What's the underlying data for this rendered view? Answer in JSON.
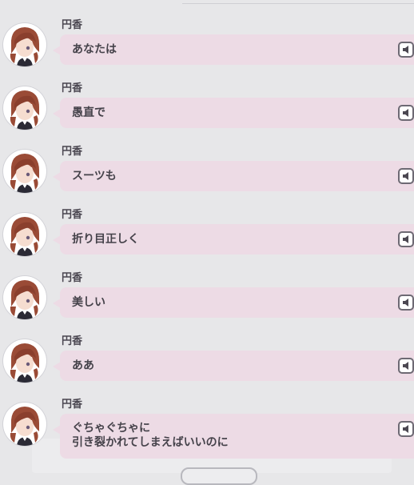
{
  "colors": {
    "background": "#e7e7e9",
    "bubble": "#eddbe5",
    "text": "#45424a",
    "name": "#4a4650"
  },
  "icons": {
    "avatar": "character-avatar-icon",
    "voice": "speaker-icon"
  },
  "messages": [
    {
      "speaker": "円香",
      "text": "あなたは"
    },
    {
      "speaker": "円香",
      "text": "愚直で"
    },
    {
      "speaker": "円香",
      "text": "スーツも"
    },
    {
      "speaker": "円香",
      "text": "折り目正しく"
    },
    {
      "speaker": "円香",
      "text": "美しい"
    },
    {
      "speaker": "円香",
      "text": "ああ"
    },
    {
      "speaker": "円香",
      "text": "ぐちゃぐちゃに\n引き裂かれてしまえばいいのに"
    }
  ]
}
